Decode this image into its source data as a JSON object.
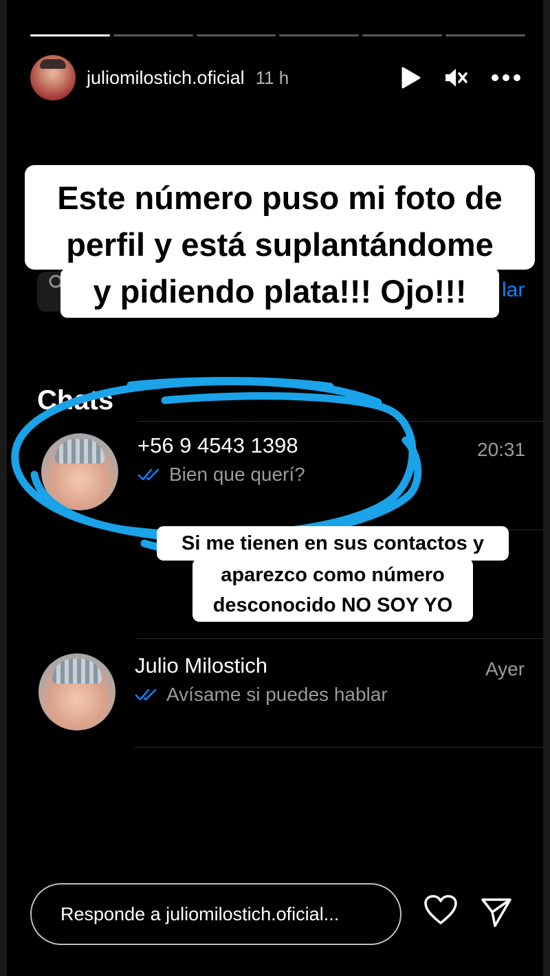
{
  "story": {
    "progress_segments": [
      {
        "fill": 1.0
      },
      {
        "fill": 0.0
      },
      {
        "fill": 0.0
      },
      {
        "fill": 0.0
      },
      {
        "fill": 0.0
      },
      {
        "fill": 0.0
      }
    ]
  },
  "header": {
    "username": "juliomilostich.oficial",
    "time": "11 h",
    "icons": [
      "play-icon",
      "mute-icon",
      "more-icon"
    ]
  },
  "screenshot": {
    "cancel_fragment": "lar",
    "chats_title": "Chats",
    "chats": [
      {
        "name": "+56 9 4543 1398",
        "message": "Bien que querí?",
        "time": "20:31"
      },
      {
        "name": "Julio Milostich",
        "message": "Avísame si puedes hablar",
        "time": "Ayer"
      }
    ]
  },
  "captions": {
    "top_line1": "Este número puso mi foto de",
    "top_line2": "perfil y está suplantándome",
    "top_line3": "y pidiendo plata!!! Ojo!!!",
    "mid_line1": "Si me tienen en sus contactos y",
    "mid_line2": "aparezco como número",
    "mid_line3": "desconocido NO SOY YO"
  },
  "footer": {
    "reply_placeholder": "Responde a juliomilostich.oficial...",
    "icons": [
      "heart-icon",
      "send-icon"
    ]
  },
  "colors": {
    "accent_blue": "#0a84ff",
    "scribble_blue": "#1aa3e8",
    "background": "#000000"
  }
}
